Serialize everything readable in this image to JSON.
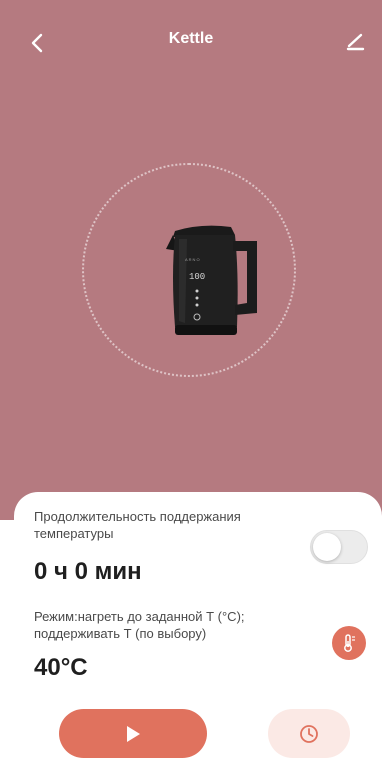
{
  "header": {
    "title": "Kettle",
    "back_icon": "chevron-left-icon",
    "edit_icon": "pencil-icon"
  },
  "device": {
    "display_value": "100",
    "image": "kettle-image"
  },
  "keep_warm": {
    "label": "Продолжительность поддержания температуры",
    "value": "0 ч 0 мин",
    "toggle_on": false
  },
  "mode": {
    "label": "Режим:нагреть до заданной Т (°C); поддерживать Т (по выбору)",
    "temperature": "40°C",
    "icon": "thermometer-icon"
  },
  "controls": {
    "play_icon": "play-icon",
    "timer_icon": "clock-icon"
  },
  "colors": {
    "hero_background": "#b57a80",
    "accent": "#e0725e",
    "accent_light": "#fbe9e5",
    "panel_background": "#ffffff"
  }
}
